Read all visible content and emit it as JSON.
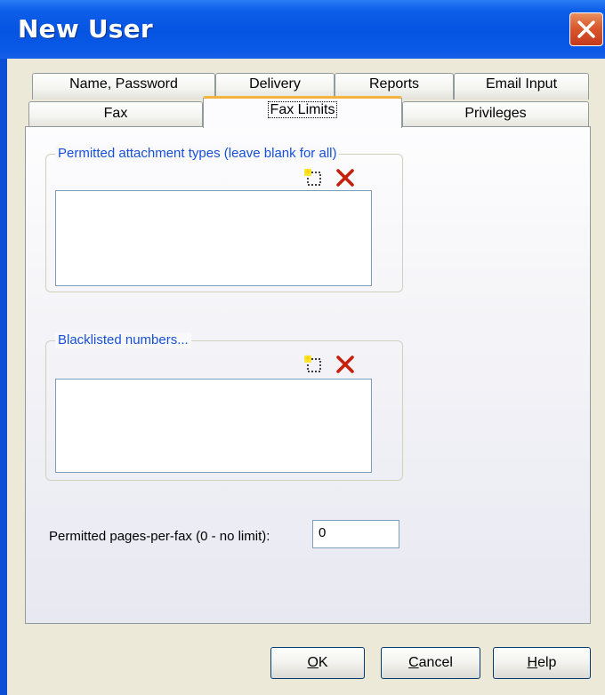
{
  "window": {
    "title": "New User"
  },
  "tabs": {
    "row1": [
      "Name, Password",
      "Delivery",
      "Reports",
      "Email Input"
    ],
    "row2": [
      "Fax",
      "Fax Limits",
      "Privileges"
    ],
    "active": "Fax Limits"
  },
  "attachments": {
    "title": "Permitted attachment types (leave blank for all)",
    "add_icon": "new-item-icon",
    "delete_icon": "delete-x-icon"
  },
  "blacklist": {
    "title": "Blacklisted numbers...",
    "add_icon": "new-item-icon",
    "delete_icon": "delete-x-icon"
  },
  "pages_per_fax": {
    "label": "Permitted pages-per-fax (0 - no limit):",
    "value": "0"
  },
  "buttons": {
    "ok": {
      "accel": "O",
      "rest": "K"
    },
    "cancel": {
      "accel": "C",
      "rest": "ancel"
    },
    "help": {
      "accel": "H",
      "rest": "elp"
    }
  },
  "colors": {
    "titlebar": "#0654e2",
    "close": "#d9582d",
    "group_title": "#1750d8",
    "delete_x": "#c81e0a",
    "active_tab_accent": "#f3b33d"
  }
}
